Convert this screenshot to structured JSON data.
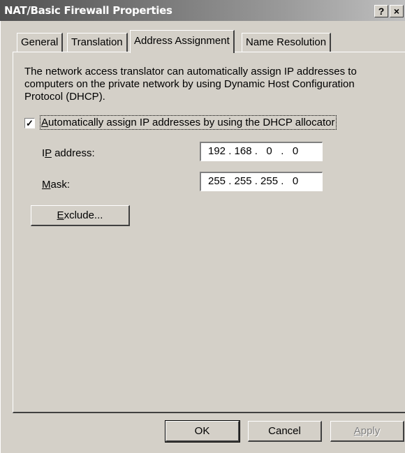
{
  "window": {
    "title": "NAT/Basic Firewall Properties",
    "help_glyph": "?",
    "close_glyph": "×"
  },
  "tabs": [
    {
      "label": "General",
      "active": false
    },
    {
      "label": "Translation",
      "active": false
    },
    {
      "label": "Address Assignment",
      "active": true
    },
    {
      "label": "Name Resolution",
      "active": false
    }
  ],
  "content": {
    "description": "The network access translator can automatically assign IP addresses to computers on the private network by using Dynamic Host Configuration Protocol (DHCP).",
    "dhcp_checkbox": {
      "checked": true,
      "check_glyph": "✓",
      "label_accel": "A",
      "label_rest": "utomatically assign IP addresses by using the DHCP allocator"
    },
    "ip_address": {
      "label_accel": "I",
      "label_mid": "P",
      "label_rest": " address:",
      "value": "192 . 168 .   0   .   0"
    },
    "mask": {
      "label_accel": "M",
      "label_rest": "ask:",
      "value": "255 . 255 . 255 .   0"
    },
    "exclude_button": {
      "label_accel": "E",
      "label_rest": "xclude..."
    }
  },
  "buttons": {
    "ok": "OK",
    "cancel": "Cancel",
    "apply_accel": "A",
    "apply_rest": "pply"
  }
}
